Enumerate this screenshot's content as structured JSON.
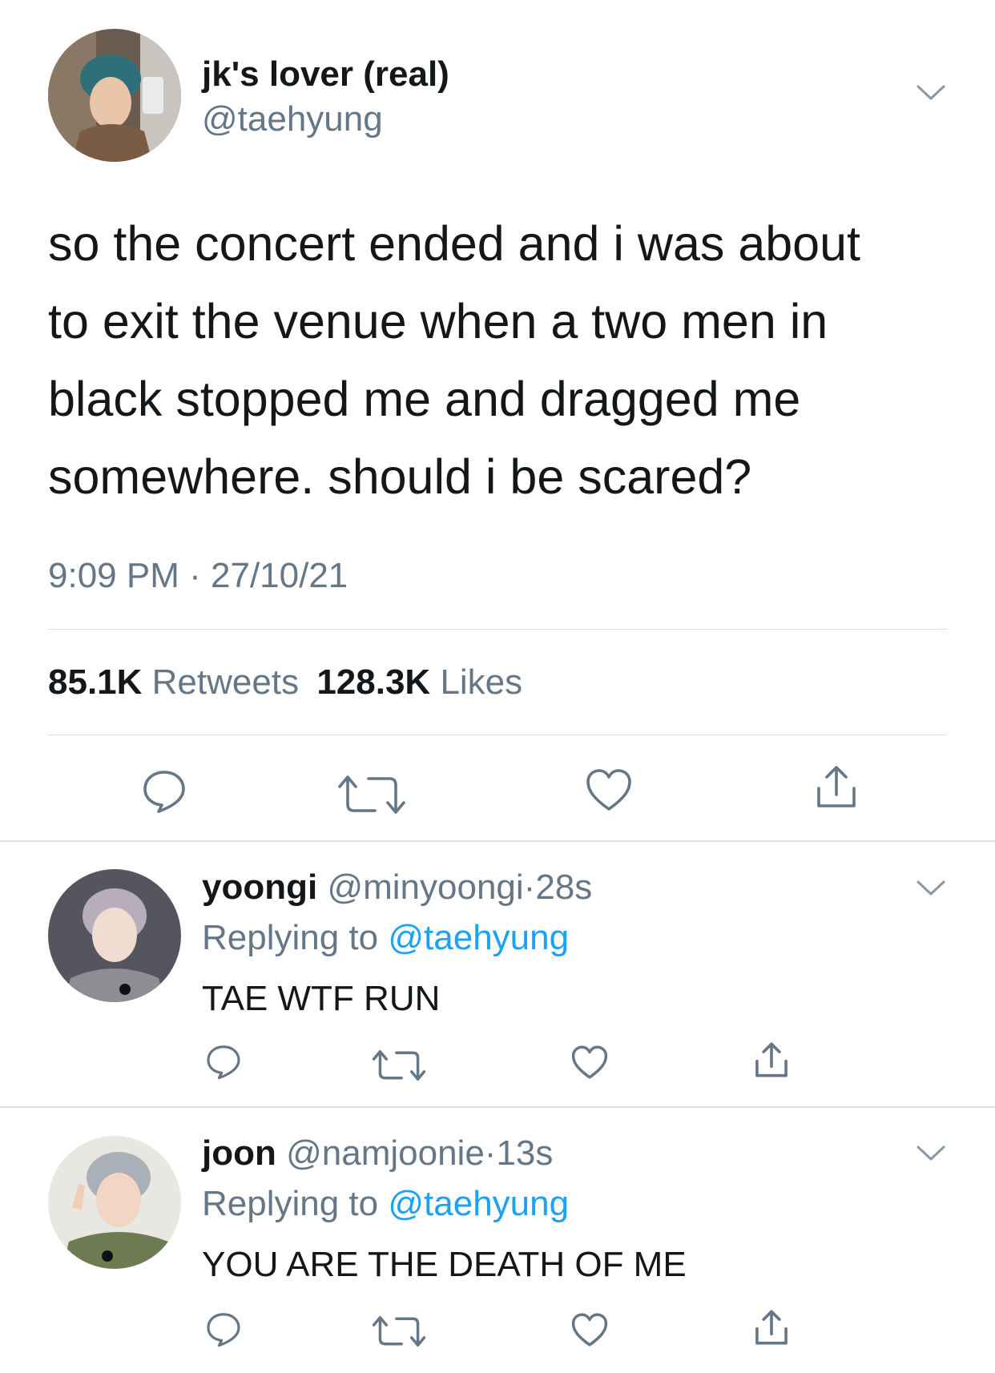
{
  "main_tweet": {
    "display_name": "jk's lover (real)",
    "handle": "@taehyung",
    "text_lines": [
      "so the concert ended and i was about",
      "to exit the venue when a two men in",
      "black stopped me and dragged me",
      "somewhere. should i be scared?"
    ],
    "time": "9:09 PM",
    "separator": "·",
    "date": "27/10/21",
    "retweets_count": "85.1K",
    "retweets_label": "Retweets",
    "likes_count": "128.3K",
    "likes_label": "Likes"
  },
  "replies": [
    {
      "display_name": "yoongi",
      "handle": "@minyoongi",
      "separator": "·",
      "age": "28s",
      "replying_prefix": "Replying to",
      "replying_to": "@taehyung",
      "text": "TAE WTF RUN"
    },
    {
      "display_name": "joon",
      "handle": "@namjoonie",
      "separator": "·",
      "age": "13s",
      "replying_prefix": "Replying to",
      "replying_to": "@taehyung",
      "text": "YOU ARE THE DEATH OF ME"
    }
  ],
  "icons": [
    "chevron-down-icon",
    "reply-icon",
    "retweet-icon",
    "like-icon",
    "share-icon"
  ],
  "colors": {
    "text": "#14171a",
    "secondary": "#657786",
    "link": "#1da1f2",
    "divider": "#d6dde3"
  }
}
